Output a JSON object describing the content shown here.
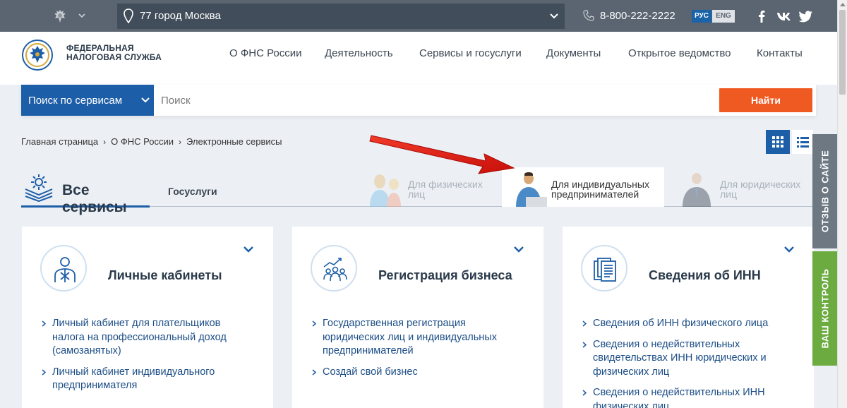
{
  "topbar": {
    "region": "77 город Москва",
    "phone": "8-800-222-2222",
    "lang_ru": "РУС",
    "lang_en": "ENG"
  },
  "header": {
    "logo_line1": "ФЕДЕРАЛЬНАЯ",
    "logo_line2": "НАЛОГОВАЯ СЛУЖБА",
    "nav": [
      "О ФНС России",
      "Деятельность",
      "Сервисы и госуслуги",
      "Документы",
      "Открытое ведомство",
      "Контакты"
    ]
  },
  "search": {
    "scope": "Поиск по сервисам",
    "placeholder": "Поиск",
    "button": "Найти"
  },
  "breadcrumb": [
    "Главная страница",
    "О ФНС России",
    "Электронные сервисы"
  ],
  "tabs": {
    "all": "Все сервисы",
    "gos": "Госуслуги"
  },
  "personas": {
    "individuals_1": "Для физических",
    "individuals_2": "лиц",
    "entrepreneurs_1": "Для индивидуальных",
    "entrepreneurs_2": "предпринимателей",
    "legal_1": "Для юридических",
    "legal_2": "лиц"
  },
  "cards": [
    {
      "title": "Личные кабинеты",
      "links": [
        "Личный кабинет для плательщиков налога на профессиональный доход (самозанятых)",
        "Личный кабинет индивидуального предпринимателя"
      ]
    },
    {
      "title": "Регистрация бизнеса",
      "links": [
        "Государственная регистрация юридических лиц и индивидуальных предпринимателей",
        "Создай свой бизнес"
      ]
    },
    {
      "title": "Сведения об ИНН",
      "links": [
        "Сведения об ИНН физического лица",
        "Сведения о недействительных свидетельствах ИНН юридических и физических лиц",
        "Сведения о недействительных ИНН физических лиц"
      ]
    }
  ],
  "side": {
    "feedback": "ОТЗЫВ О САЙТЕ",
    "control": "ВАШ КОНТРОЛЬ"
  },
  "colors": {
    "topbar": "#5a6571",
    "accent_blue": "#1d5ea8",
    "search_button": "#ef5a23",
    "control_tab": "#6cab3f",
    "link": "#1b4d86"
  }
}
